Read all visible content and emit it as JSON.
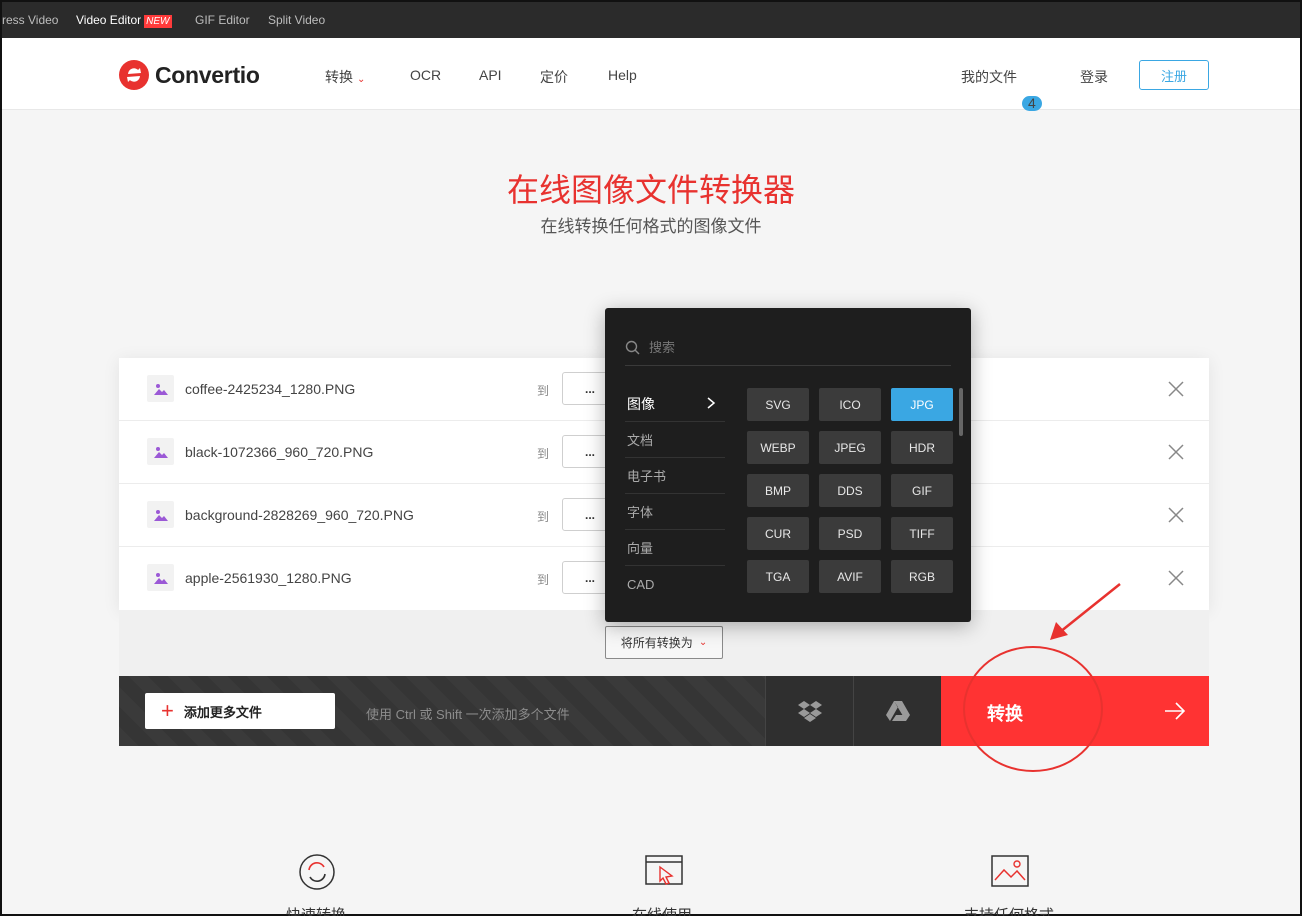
{
  "topstrip": {
    "items": [
      "ress Video",
      "Video Editor",
      "GIF Editor",
      "Split Video"
    ],
    "new_badge": "NEW"
  },
  "header": {
    "logo": "Convertio",
    "nav": [
      "转换",
      "OCR",
      "API",
      "定价",
      "Help"
    ],
    "my_files": "我的文件",
    "files_count": "4",
    "login": "登录",
    "signup": "注册"
  },
  "hero": {
    "title": "在线图像文件转换器",
    "subtitle": "在线转换任何格式的图像文件"
  },
  "files": [
    {
      "name": "coffee-2425234_1280.PNG",
      "to": "到",
      "select": "..."
    },
    {
      "name": "black-1072366_960_720.PNG",
      "to": "到",
      "select": "..."
    },
    {
      "name": "background-2828269_960_720.PNG",
      "to": "到",
      "select": "..."
    },
    {
      "name": "apple-2561930_1280.PNG",
      "to": "到",
      "select": "..."
    }
  ],
  "convert_all": "将所有转换为",
  "bar": {
    "add_more": "添加更多文件",
    "hint": "使用 Ctrl 或 Shift 一次添加多个文件",
    "convert": "转换"
  },
  "dropdown": {
    "search_placeholder": "搜索",
    "categories": [
      "图像",
      "文档",
      "电子书",
      "字体",
      "向量",
      "CAD"
    ],
    "active_category": "图像",
    "formats": [
      "SVG",
      "ICO",
      "JPG",
      "WEBP",
      "JPEG",
      "HDR",
      "BMP",
      "DDS",
      "GIF",
      "CUR",
      "PSD",
      "TIFF",
      "TGA",
      "AVIF",
      "RGB"
    ],
    "selected_format": "JPG"
  },
  "features": [
    "快速转换",
    "在线使用",
    "支持任何格式"
  ],
  "colors": {
    "accent_red": "#ff3333",
    "accent_blue": "#3aa7e3",
    "dropdown_bg": "#1e1e1e"
  }
}
